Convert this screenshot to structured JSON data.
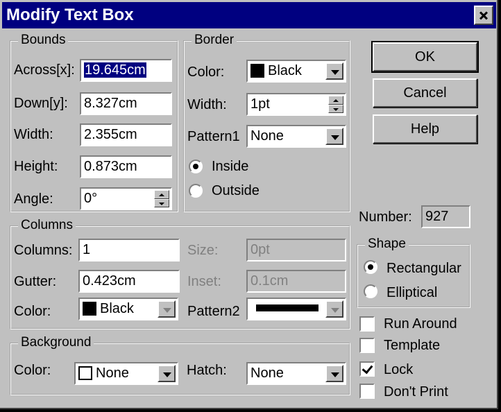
{
  "dialog": {
    "title": "Modify Text Box"
  },
  "bounds": {
    "legend": "Bounds",
    "across_label": "Across[x]:",
    "across_value": "19.645cm",
    "down_label": "Down[y]:",
    "down_value": "8.327cm",
    "width_label": "Width:",
    "width_value": "2.355cm",
    "height_label": "Height:",
    "height_value": "0.873cm",
    "angle_label": "Angle:",
    "angle_value": "0°"
  },
  "border": {
    "legend": "Border",
    "color_label": "Color:",
    "color_value": "Black",
    "color_swatch": "#000000",
    "width_label": "Width:",
    "width_value": "1pt",
    "pattern_label": "Pattern1",
    "pattern_value": "None",
    "inside_label": "Inside",
    "outside_label": "Outside",
    "selected": "Inside"
  },
  "columns": {
    "legend": "Columns",
    "columns_label": "Columns:",
    "columns_value": "1",
    "gutter_label": "Gutter:",
    "gutter_value": "0.423cm",
    "color_label": "Color:",
    "color_value": "Black",
    "color_swatch": "#000000",
    "size_label": "Size:",
    "size_value": "0pt",
    "inset_label": "Inset:",
    "inset_value": "0.1cm",
    "pattern_label": "Pattern2"
  },
  "background": {
    "legend": "Background",
    "color_label": "Color:",
    "color_value": "None",
    "color_swatch": "#ffffff",
    "hatch_label": "Hatch:",
    "hatch_value": "None"
  },
  "buttons": {
    "ok": "OK",
    "cancel": "Cancel",
    "help": "Help"
  },
  "number": {
    "label": "Number:",
    "value": "927"
  },
  "shape": {
    "legend": "Shape",
    "rectangular_label": "Rectangular",
    "elliptical_label": "Elliptical",
    "selected": "Rectangular"
  },
  "options": {
    "run_around_label": "Run Around",
    "run_around": false,
    "template_label": "Template",
    "template": false,
    "lock_label": "Lock",
    "lock": true,
    "dont_print_label": "Don't Print",
    "dont_print": false
  }
}
